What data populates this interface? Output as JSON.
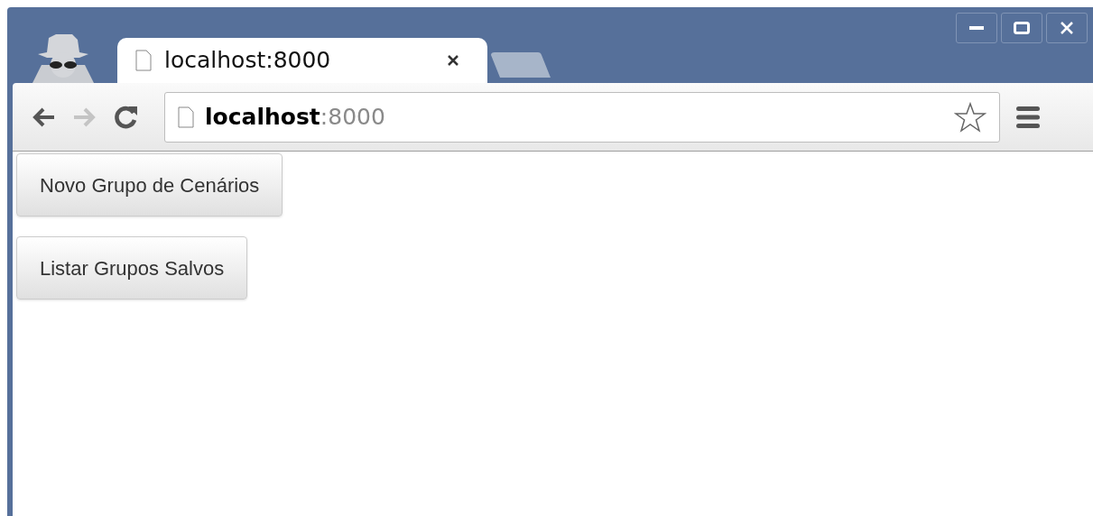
{
  "tabs": [
    {
      "title": "localhost:8000",
      "selected": true
    }
  ],
  "address_bar": {
    "host": "localhost",
    "port": ":8000"
  },
  "navigation": {
    "back_disabled": false,
    "forward_disabled": true
  },
  "buttons": [
    "Novo Grupo de Cenários",
    "Listar Grupos Salvos"
  ]
}
